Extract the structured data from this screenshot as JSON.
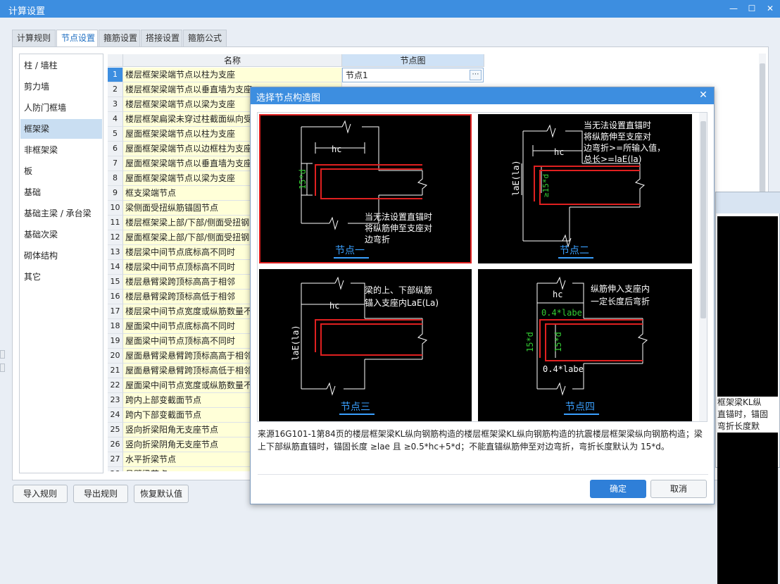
{
  "window": {
    "title": "计算设置",
    "min": "—",
    "max": "☐",
    "close": "✕"
  },
  "tabs": [
    "计算规则",
    "节点设置",
    "箍筋设置",
    "搭接设置",
    "箍筋公式"
  ],
  "active_tab": 1,
  "sidebar": {
    "items": [
      "柱 / 墙柱",
      "剪力墙",
      "人防门框墙",
      "框架梁",
      "非框架梁",
      "板",
      "基础",
      "基础主梁 / 承台梁",
      "基础次梁",
      "砌体结构",
      "其它"
    ],
    "active": 3
  },
  "table": {
    "headers": {
      "name": "名称",
      "node": "节点图"
    },
    "rows": [
      {
        "n": "1",
        "name": "楼层框架梁端节点以柱为支座",
        "node": "节点1"
      },
      {
        "n": "2",
        "name": "楼层框架梁端节点以垂直墙为支座"
      },
      {
        "n": "3",
        "name": "楼层框架梁端节点以梁为支座"
      },
      {
        "n": "4",
        "name": "楼层框架扁梁未穿过柱截面纵向受"
      },
      {
        "n": "5",
        "name": "屋面框架梁端节点以柱为支座"
      },
      {
        "n": "6",
        "name": "屋面框架梁端节点以边框柱为支座"
      },
      {
        "n": "7",
        "name": "屋面框架梁端节点以垂直墙为支座"
      },
      {
        "n": "8",
        "name": "屋面框架梁端节点以梁为支座"
      },
      {
        "n": "9",
        "name": "框支梁端节点"
      },
      {
        "n": "10",
        "name": "梁侧面受扭纵筋锚固节点"
      },
      {
        "n": "11",
        "name": "楼层框架梁上部/下部/侧面受扭钢"
      },
      {
        "n": "12",
        "name": "屋面框架梁上部/下部/侧面受扭钢"
      },
      {
        "n": "13",
        "name": "楼层梁中间节点底标高不同时"
      },
      {
        "n": "14",
        "name": "楼层梁中间节点顶标高不同时"
      },
      {
        "n": "15",
        "name": "楼层悬臂梁跨顶标高高于相邻"
      },
      {
        "n": "16",
        "name": "楼层悬臂梁跨顶标高低于相邻"
      },
      {
        "n": "17",
        "name": "楼层梁中间节点宽度或纵筋数量不"
      },
      {
        "n": "18",
        "name": "屋面梁中间节点底标高不同时"
      },
      {
        "n": "19",
        "name": "屋面梁中间节点顶标高不同时"
      },
      {
        "n": "20",
        "name": "屋面悬臂梁悬臂跨顶标高高于相邻"
      },
      {
        "n": "21",
        "name": "屋面悬臂梁悬臂跨顶标高低于相邻"
      },
      {
        "n": "22",
        "name": "屋面梁中间节点宽度或纵筋数量不"
      },
      {
        "n": "23",
        "name": "跨内上部变截面节点"
      },
      {
        "n": "24",
        "name": "跨内下部变截面节点"
      },
      {
        "n": "25",
        "name": "竖向折梁阳角无支座节点"
      },
      {
        "n": "26",
        "name": "竖向折梁阴角无支座节点"
      },
      {
        "n": "27",
        "name": "水平折梁节点"
      },
      {
        "n": "28",
        "name": "悬臂梁节点"
      }
    ],
    "ellipsis": "⋯"
  },
  "buttons": {
    "import": "导入规则",
    "export": "导出规则",
    "restore": "恢复默认值"
  },
  "background_panel_text": "框架梁KL纵\n直锚时，锚固\n弯折长度默",
  "dialog": {
    "title": "选择节点构造图",
    "close": "✕",
    "cells": [
      {
        "caption": "节点一",
        "hc": "hc",
        "dim": "15*d",
        "note": [
          "当无法设置直锚时",
          "将纵筋伸至支座对",
          "边弯折"
        ]
      },
      {
        "caption": "节点二",
        "hc": "hc",
        "dim": "laE(la)",
        "dim2": "≥15*d",
        "note": [
          "当无法设置直锚时",
          "将纵筋伸至支座对",
          "边弯折>=所输入值，",
          "总长>=laE(la)"
        ]
      },
      {
        "caption": "节点三",
        "hc": "hc",
        "dim": "laE(la)",
        "note": [
          "梁的上、下部纵筋",
          "锚入支座内LaE(La)"
        ]
      },
      {
        "caption": "节点四",
        "hc": "hc",
        "dim": "15*d",
        "dim2": "15*d",
        "top": "0.4*labe",
        "bottom": "0.4*labe",
        "note": [
          "纵筋伸入支座内",
          "一定长度后弯折"
        ]
      }
    ],
    "selected": 0,
    "description": "来源16G101-1第84页的楼层框架梁KL纵向钢筋构造的楼层框架梁KL纵向钢筋构造的抗震楼层框架梁纵向钢筋构造；梁上下部纵筋直锚时，锚固长度 ≥lae 且 ≥0.5*hc+5*d；不能直锚纵筋伸至对边弯折，弯折长度默认为 15*d。",
    "ok": "确定",
    "cancel": "取消"
  },
  "colors": {
    "accent": "#3d8ee0",
    "rebar": "#e02020",
    "dim_green": "#33cc33",
    "caption": "#3aa0ff"
  }
}
